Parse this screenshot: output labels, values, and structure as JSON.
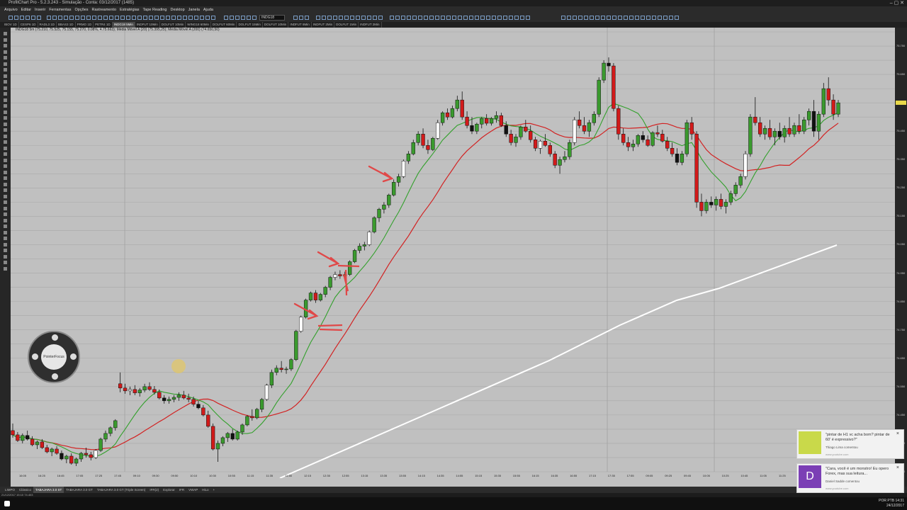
{
  "window": {
    "title": "ProfitChart Pro - 5.2.3.243 - Simulação - Conta: 03/12/2017 (1485)",
    "controls": "–  ▢  ✕"
  },
  "menu": [
    "Arquivo",
    "Editar",
    "Inserir",
    "Ferramentas",
    "Opções",
    "Rastreamento",
    "Estratégias",
    "Tape Reading",
    "Desktop",
    "Janela",
    "Ajuda"
  ],
  "toolbar": {
    "symbol_value": "INDG18"
  },
  "chart_tabs": [
    {
      "label": "IBOV 1D",
      "active": false
    },
    {
      "label": "CESP6 1D",
      "active": false
    },
    {
      "label": "RADL3 1D",
      "active": false
    },
    {
      "label": "BBAS3 1D",
      "active": false
    },
    {
      "label": "PRMO 1D",
      "active": false
    },
    {
      "label": "PETR4 1D",
      "active": false
    },
    {
      "label": "INDG18 5Min",
      "active": true
    },
    {
      "label": "INDFUT 10Min",
      "active": false
    },
    {
      "label": "DOLFUT 10Min",
      "active": false
    },
    {
      "label": "WING18 60Min",
      "active": false
    },
    {
      "label": "DOLFUT 60Min",
      "active": false
    },
    {
      "label": "DOLFUT 15Min",
      "active": false
    },
    {
      "label": "DOLFUT 10Min",
      "active": false
    },
    {
      "label": "INDFUT 8Min",
      "active": false
    },
    {
      "label": "INDFUT 2Min",
      "active": false
    },
    {
      "label": "DOLFUT 1Min",
      "active": false
    },
    {
      "label": "INDFUT 2Min",
      "active": false
    }
  ],
  "legend": "INDG18 5m (75.210, 75.525, 75.155, 75.270, 0.08%, 4.75.663); Média Móvel A (20) (75.395,25); Média Móvel A (200) (74.650,50)",
  "pointer_focus_label": "PointerFocus",
  "bottom_tabs": [
    {
      "label": "LIMPO",
      "active": false
    },
    {
      "label": "Clássico",
      "active": false
    },
    {
      "label": "TABAJARA 3.0 ST",
      "active": true
    },
    {
      "label": "TABAJARA 3.0 GT",
      "active": false
    },
    {
      "label": "TABAJARA 3.0 GT (Triple Screen)",
      "active": false
    },
    {
      "label": "IFR(2)",
      "active": false
    },
    {
      "label": "Explorar",
      "active": false
    },
    {
      "label": "IFR",
      "active": false
    },
    {
      "label": "VWAP",
      "active": false
    },
    {
      "label": "HiLo",
      "active": false
    },
    {
      "label": "+",
      "active": false
    }
  ],
  "status": "21/12/2017 15:10   74.403",
  "tray": {
    "lang": "POR PTB",
    "time": "14:31",
    "date": "24/12/2017",
    "conn": "Conectado"
  },
  "toasts": [
    {
      "text": "\"pintar de H1 vc acha bom? pintar de 60' é expressivo?\"",
      "author": "Thiago Lima comentou",
      "source": "www.youtube.com"
    },
    {
      "text": "\"Cara, você é um monstro! Eu opero Forex, mas sua leitura...",
      "author": "Daniel Sadde comentou",
      "source": "www.youtube.com",
      "initial": "D"
    }
  ],
  "colors": {
    "bull": "#3a9a2e",
    "bear": "#d21a1a",
    "ma20": "#d22222",
    "ma_fast": "#33a02c",
    "ma200": "#ffffff",
    "bg": "#c0c0c0",
    "grid": "#a8a8a8"
  },
  "icons": [
    "arrow-annotation-icon",
    "pointer-focus-icon",
    "close-icon",
    "windows-start-icon"
  ],
  "chart_data": {
    "type": "candlestick",
    "title": "",
    "symbol": "INDG18",
    "timeframe": "5Min",
    "ylim": [
      74250,
      75800
    ],
    "xticks": [
      "16:05",
      "16:25",
      "16:45",
      "17:05",
      "17:25",
      "17:45",
      "09:10",
      "09:30",
      "09:50",
      "10:10",
      "10:30",
      "10:55",
      "11:15",
      "11:35",
      "11:55",
      "12:15",
      "12:35",
      "12:55",
      "13:15",
      "13:35",
      "13:55",
      "14:15",
      "14:35",
      "14:55",
      "15:15",
      "15:35",
      "15:55",
      "16:15",
      "16:35",
      "16:55",
      "17:15",
      "17:35",
      "17:55",
      "09:05",
      "09:25",
      "09:45",
      "10:05",
      "10:25",
      "10:45",
      "11:05",
      "11:25",
      "11:45",
      "12:05"
    ],
    "xsessions": [
      "20/dez",
      "21/dez",
      "22/dez"
    ],
    "moving_averages": [
      {
        "name": "Média Móvel A (20)",
        "color": "#d22222"
      },
      {
        "name": "Média Móvel A (200)",
        "color": "#ffffff"
      }
    ],
    "candles": [
      [
        74395,
        74420,
        74370,
        74380
      ],
      [
        74380,
        74390,
        74355,
        74360
      ],
      [
        74360,
        74385,
        74350,
        74378
      ],
      [
        74378,
        74395,
        74360,
        74365
      ],
      [
        74365,
        74375,
        74340,
        74345
      ],
      [
        74345,
        74360,
        74330,
        74355
      ],
      [
        74355,
        74365,
        74330,
        74335
      ],
      [
        74335,
        74345,
        74315,
        74320
      ],
      [
        74320,
        74335,
        74305,
        74330
      ],
      [
        74330,
        74340,
        74310,
        74315
      ],
      [
        74315,
        74325,
        74290,
        74295
      ],
      [
        74295,
        74310,
        74280,
        74305
      ],
      [
        74305,
        74315,
        74275,
        74280
      ],
      [
        74280,
        74300,
        74270,
        74295
      ],
      [
        74295,
        74320,
        74285,
        74315
      ],
      [
        74315,
        74335,
        74300,
        74310
      ],
      [
        74310,
        74320,
        74290,
        74300
      ],
      [
        74300,
        74330,
        74295,
        74325
      ],
      [
        74325,
        74370,
        74320,
        74365
      ],
      [
        74365,
        74395,
        74355,
        74385
      ],
      [
        74385,
        74410,
        74375,
        74405
      ],
      [
        74405,
        74435,
        74395,
        74430
      ],
      [
        74560,
        74600,
        74530,
        74545
      ],
      [
        74545,
        74560,
        74525,
        74535
      ],
      [
        74535,
        74550,
        74520,
        74540
      ],
      [
        74540,
        74555,
        74520,
        74528
      ],
      [
        74528,
        74545,
        74515,
        74538
      ],
      [
        74538,
        74560,
        74530,
        74550
      ],
      [
        74550,
        74565,
        74535,
        74540
      ],
      [
        74540,
        74552,
        74522,
        74530
      ],
      [
        74530,
        74540,
        74505,
        74510
      ],
      [
        74510,
        74520,
        74490,
        74500
      ],
      [
        74500,
        74515,
        74490,
        74505
      ],
      [
        74505,
        74520,
        74495,
        74512
      ],
      [
        74512,
        74530,
        74500,
        74520
      ],
      [
        74520,
        74535,
        74505,
        74510
      ],
      [
        74510,
        74525,
        74495,
        74505
      ],
      [
        74505,
        74515,
        74480,
        74488
      ],
      [
        74488,
        74500,
        74470,
        74475
      ],
      [
        74475,
        74485,
        74445,
        74450
      ],
      [
        74450,
        74465,
        74405,
        74410
      ],
      [
        74410,
        74420,
        74325,
        74330
      ],
      [
        74330,
        74360,
        74285,
        74350
      ],
      [
        74350,
        74375,
        74340,
        74370
      ],
      [
        74370,
        74390,
        74355,
        74385
      ],
      [
        74385,
        74400,
        74360,
        74365
      ],
      [
        74365,
        74395,
        74360,
        74390
      ],
      [
        74390,
        74420,
        74380,
        74415
      ],
      [
        74415,
        74450,
        74410,
        74445
      ],
      [
        74445,
        74470,
        74430,
        74440
      ],
      [
        74440,
        74475,
        74435,
        74470
      ],
      [
        74470,
        74510,
        74460,
        74505
      ],
      [
        74505,
        74560,
        74500,
        74555
      ],
      [
        74555,
        74610,
        74545,
        74600
      ],
      [
        74600,
        74625,
        74590,
        74615
      ],
      [
        74615,
        74640,
        74600,
        74610
      ],
      [
        74610,
        74620,
        74595,
        74612
      ],
      [
        74612,
        74650,
        74605,
        74645
      ],
      [
        74645,
        74750,
        74640,
        74745
      ],
      [
        74745,
        74800,
        74740,
        74795
      ],
      [
        74795,
        74860,
        74790,
        74855
      ],
      [
        74855,
        74885,
        74850,
        74880
      ],
      [
        74880,
        74890,
        74845,
        74855
      ],
      [
        74855,
        74880,
        74850,
        74875
      ],
      [
        74875,
        74905,
        74865,
        74900
      ],
      [
        74900,
        74940,
        74890,
        74935
      ],
      [
        74935,
        74955,
        74925,
        74945
      ],
      [
        74945,
        74960,
        74930,
        74940
      ],
      [
        74940,
        74955,
        74925,
        74945
      ],
      [
        74945,
        74995,
        74940,
        74990
      ],
      [
        74990,
        75035,
        74985,
        75030
      ],
      [
        75030,
        75055,
        75020,
        75045
      ],
      [
        75045,
        75060,
        75030,
        75050
      ],
      [
        75050,
        75100,
        75045,
        75095
      ],
      [
        75095,
        75150,
        75090,
        75145
      ],
      [
        75145,
        75180,
        75130,
        75175
      ],
      [
        75175,
        75200,
        75160,
        75190
      ],
      [
        75190,
        75230,
        75180,
        75225
      ],
      [
        75225,
        75280,
        75220,
        75270
      ],
      [
        75270,
        75300,
        75255,
        75290
      ],
      [
        75290,
        75350,
        75285,
        75345
      ],
      [
        75345,
        75380,
        75335,
        75370
      ],
      [
        75370,
        75420,
        75365,
        75410
      ],
      [
        75410,
        75450,
        75400,
        75440
      ],
      [
        75440,
        75460,
        75390,
        75400
      ],
      [
        75400,
        75420,
        75370,
        75385
      ],
      [
        75385,
        75430,
        75380,
        75425
      ],
      [
        75425,
        75490,
        75420,
        75480
      ],
      [
        75480,
        75520,
        75470,
        75515
      ],
      [
        75515,
        75530,
        75490,
        75500
      ],
      [
        75500,
        75540,
        75495,
        75530
      ],
      [
        75530,
        75575,
        75520,
        75560
      ],
      [
        75560,
        75590,
        75490,
        75500
      ],
      [
        75500,
        75520,
        75460,
        75470
      ],
      [
        75470,
        75500,
        75440,
        75450
      ],
      [
        75450,
        75480,
        75440,
        75475
      ],
      [
        75475,
        75500,
        75460,
        75495
      ],
      [
        75495,
        75510,
        75470,
        75478
      ],
      [
        75478,
        75500,
        75470,
        75495
      ],
      [
        75495,
        75520,
        75480,
        75505
      ],
      [
        75505,
        75515,
        75465,
        75470
      ],
      [
        75470,
        75485,
        75430,
        75440
      ],
      [
        75440,
        75455,
        75400,
        75410
      ],
      [
        75410,
        75440,
        75395,
        75430
      ],
      [
        75430,
        75470,
        75420,
        75465
      ],
      [
        75465,
        75490,
        75445,
        75450
      ],
      [
        75450,
        75470,
        75410,
        75420
      ],
      [
        75420,
        75430,
        75380,
        75390
      ],
      [
        75390,
        75420,
        75370,
        75415
      ],
      [
        75415,
        75440,
        75395,
        75400
      ],
      [
        75400,
        75410,
        75360,
        75370
      ],
      [
        75370,
        75380,
        75320,
        75330
      ],
      [
        75330,
        75360,
        75300,
        75350
      ],
      [
        75350,
        75380,
        75340,
        75360
      ],
      [
        75360,
        75420,
        75350,
        75410
      ],
      [
        75410,
        75500,
        75400,
        75490
      ],
      [
        75490,
        75520,
        75460,
        75470
      ],
      [
        75470,
        75500,
        75440,
        75450
      ],
      [
        75450,
        75490,
        75430,
        75480
      ],
      [
        75480,
        75520,
        75470,
        75510
      ],
      [
        75510,
        75640,
        75500,
        75630
      ],
      [
        75630,
        75700,
        75620,
        75690
      ],
      [
        75690,
        75710,
        75660,
        75680
      ],
      [
        75680,
        75690,
        75520,
        75530
      ],
      [
        75530,
        75540,
        75420,
        75440
      ],
      [
        75440,
        75460,
        75400,
        75410
      ],
      [
        75410,
        75430,
        75380,
        75395
      ],
      [
        75395,
        75420,
        75380,
        75405
      ],
      [
        75405,
        75440,
        75395,
        75435
      ],
      [
        75435,
        75450,
        75410,
        75420
      ],
      [
        75420,
        75435,
        75395,
        75400
      ],
      [
        75400,
        75450,
        75395,
        75445
      ],
      [
        75445,
        75470,
        75430,
        75440
      ],
      [
        75440,
        75455,
        75410,
        75415
      ],
      [
        75415,
        75430,
        75380,
        75390
      ],
      [
        75390,
        75410,
        75360,
        75370
      ],
      [
        75370,
        75390,
        75330,
        75340
      ],
      [
        75340,
        75380,
        75330,
        75370
      ],
      [
        75370,
        75490,
        75360,
        75480
      ],
      [
        75480,
        75500,
        75420,
        75440
      ],
      [
        75440,
        75450,
        75180,
        75200
      ],
      [
        75200,
        75230,
        75150,
        75170
      ],
      [
        75170,
        75210,
        75160,
        75200
      ],
      [
        75200,
        75220,
        75180,
        75190
      ],
      [
        75190,
        75220,
        75170,
        75210
      ],
      [
        75210,
        75230,
        75175,
        75185
      ],
      [
        75185,
        75210,
        75160,
        75200
      ],
      [
        75200,
        75240,
        75190,
        75230
      ],
      [
        75230,
        75270,
        75220,
        75260
      ],
      [
        75260,
        75300,
        75250,
        75290
      ],
      [
        75290,
        75380,
        75280,
        75370
      ],
      [
        75370,
        75510,
        75360,
        75500
      ],
      [
        75500,
        75570,
        75470,
        75480
      ],
      [
        75480,
        75500,
        75430,
        75440
      ],
      [
        75440,
        75470,
        75420,
        75460
      ],
      [
        75460,
        75490,
        75420,
        75430
      ],
      [
        75430,
        75460,
        75400,
        75450
      ],
      [
        75450,
        75480,
        75420,
        75430
      ],
      [
        75430,
        75470,
        75410,
        75460
      ],
      [
        75460,
        75500,
        75430,
        75440
      ],
      [
        75440,
        75480,
        75430,
        75470
      ],
      [
        75470,
        75510,
        75440,
        75450
      ],
      [
        75450,
        75500,
        75440,
        75490
      ],
      [
        75490,
        75530,
        75470,
        75520
      ],
      [
        75520,
        75560,
        75430,
        75450
      ],
      [
        75450,
        75520,
        75420,
        75510
      ],
      [
        75510,
        75620,
        75500,
        75600
      ],
      [
        75600,
        75640,
        75540,
        75560
      ],
      [
        75560,
        75580,
        75490,
        75510
      ],
      [
        75510,
        75560,
        75500,
        75550
      ]
    ]
  }
}
